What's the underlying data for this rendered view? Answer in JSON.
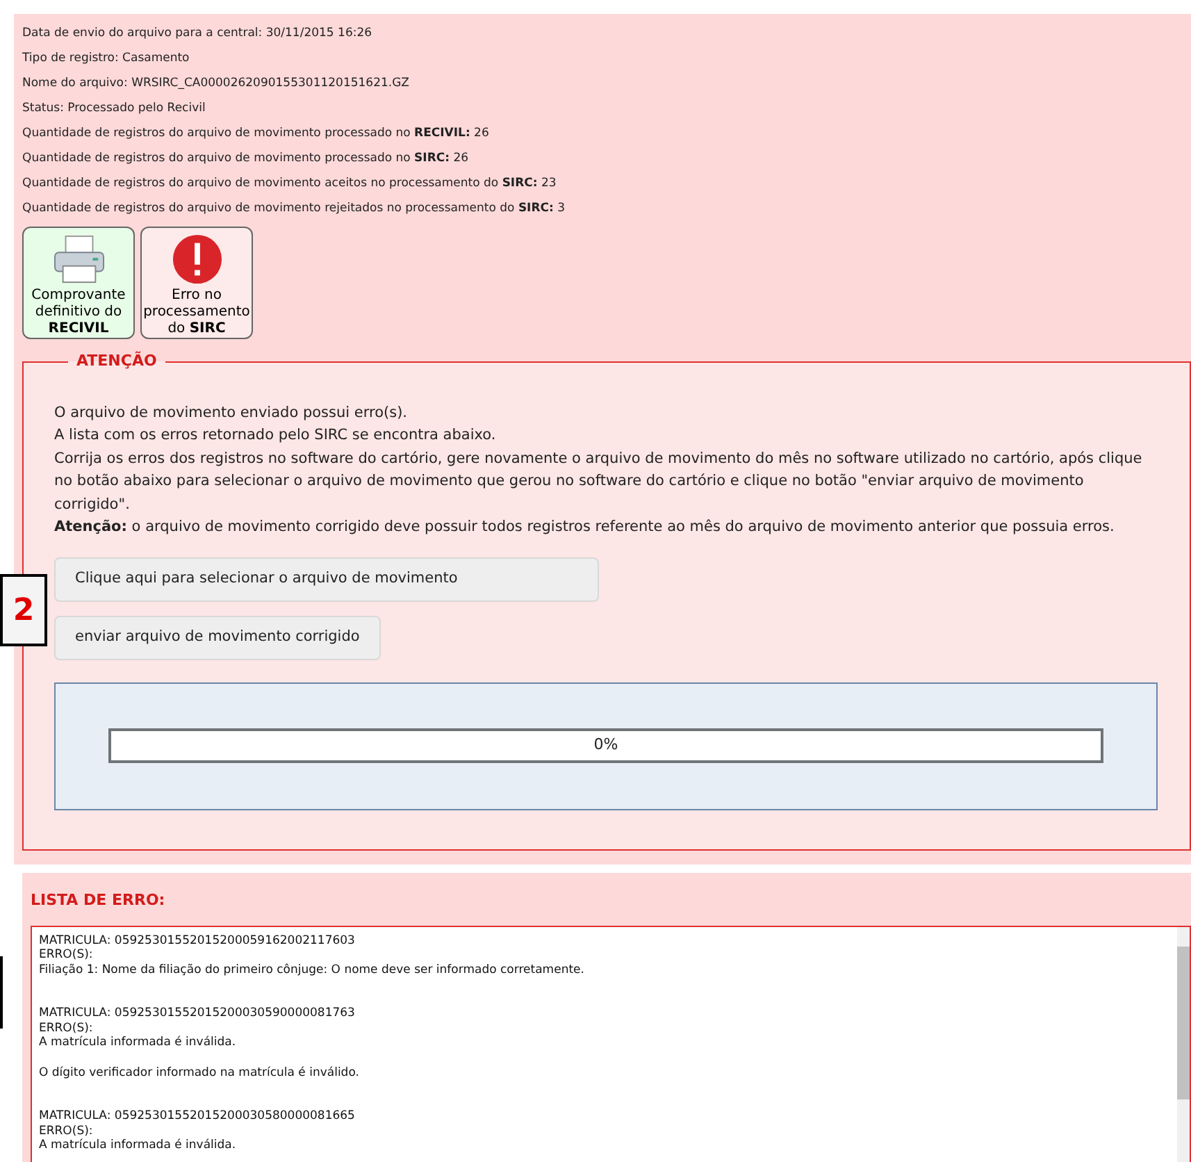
{
  "info_lines": [
    "Data de envio do arquivo para a central: 30/11/2015 16:26",
    "Tipo de registro: Casamento",
    "Nome do arquivo: WRSIRC_CA0000262090155301120151621.GZ",
    "Status: Processado pelo Recivil",
    "Quantidade de registros do arquivo de movimento processado no **RECIVIL:** 26",
    "Quantidade de registros do arquivo de movimento processado no **SIRC:** 26",
    "Quantidade de registros do arquivo de movimento aceitos no processamento do **SIRC:** 23",
    "Quantidade de registros do arquivo de movimento rejeitados no processamento do **SIRC:** 3"
  ],
  "action_tiles": [
    {
      "kind": "print",
      "label": "Comprovante definitivo do **RECIVIL**"
    },
    {
      "kind": "error",
      "label": "Erro no processamento do **SIRC**"
    }
  ],
  "attention": {
    "legend": "ATENÇÃO",
    "lines": [
      "O arquivo de movimento enviado possui erro(s).",
      "A lista com os erros retornado pelo SIRC se encontra abaixo.",
      "Corrija os erros dos registros no software do cartório, gere novamente o arquivo de movimento do mês no software utilizado no cartório, após clique no botão abaixo para selecionar o arquivo de movimento que gerou no software do cartório e clique no botão \"enviar arquivo de movimento corrigido\".",
      "**Atenção:** o arquivo de movimento corrigido deve possuir todos registros referente ao mês do arquivo de movimento anterior que possuia erros."
    ],
    "select_button": "Clique aqui para selecionar o arquivo de movimento",
    "send_button": "enviar arquivo de movimento corrigido",
    "progress": {
      "level": 0,
      "reading": "0%"
    }
  },
  "callout": "2",
  "error_list": {
    "title": "LISTA DE ERRO:",
    "entries": [
      {
        "matricula": "MATRICULA: 05925301552015200059162002117603",
        "errors_label": "ERRO(S):",
        "messages": [
          "Filiação 1: Nome da filiação do primeiro cônjuge: O nome deve ser informado corretamente."
        ]
      },
      {
        "matricula": "MATRICULA: 05925301552015200030590000081763",
        "errors_label": "ERRO(S):",
        "messages": [
          "A matrícula informada é inválida.",
          "O dígito verificador informado na matrícula é inválido."
        ]
      },
      {
        "matricula": "MATRICULA: 05925301552015200030580000081665",
        "errors_label": "ERRO(S):",
        "messages": [
          "A matrícula informada é inválida."
        ]
      }
    ]
  }
}
